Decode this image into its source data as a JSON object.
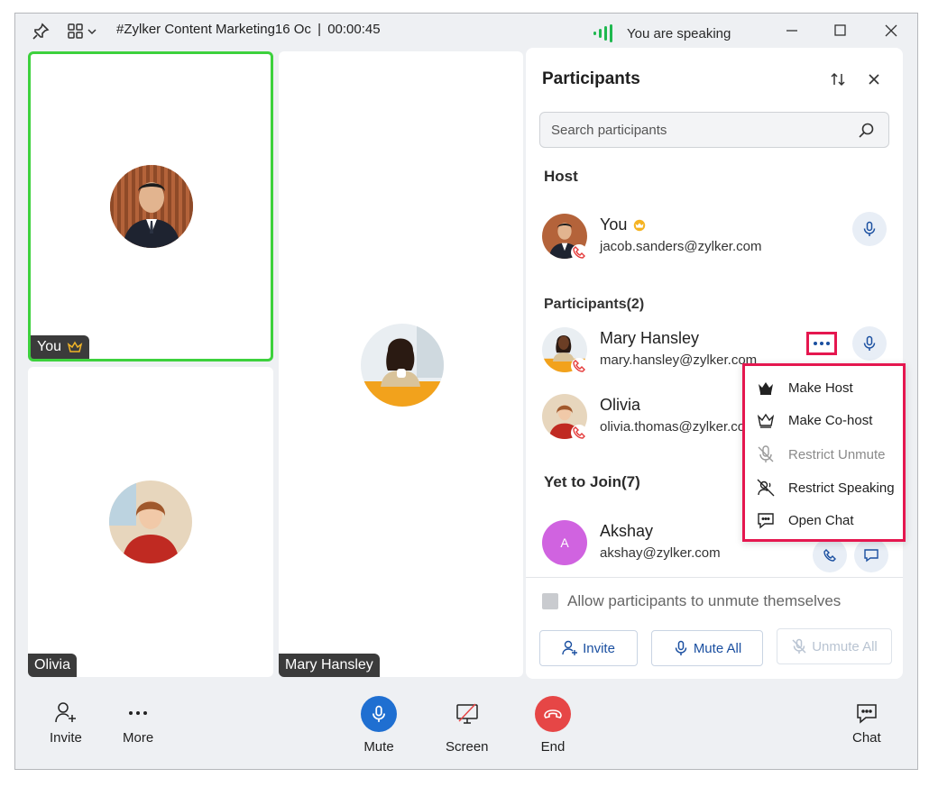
{
  "titlebar": {
    "meeting_title": "#Zylker Content Marketing16 Oc",
    "separator": "|",
    "timer": "00:00:45",
    "speaking_status": "You are speaking",
    "speaking_color": "#1fb84f"
  },
  "tiles": {
    "you_label": "You",
    "olivia_label": "Olivia",
    "mary_label": "Mary Hansley",
    "active_border_color": "#3dd13d"
  },
  "panel": {
    "title": "Participants",
    "search_placeholder": "Search participants",
    "host_heading": "Host",
    "host": {
      "name": "You",
      "email": "jacob.sanders@zylker.com"
    },
    "participants_heading": "Participants(2)",
    "participants": [
      {
        "name": "Mary Hansley",
        "email": "mary.hansley@zylker.com"
      },
      {
        "name": "Olivia",
        "email": "olivia.thomas@zylker.com"
      }
    ],
    "yet_to_join_heading": "Yet to Join(7)",
    "yet_to_join": [
      {
        "initial": "A",
        "name": "Akshay",
        "email": "akshay@zylker.com"
      }
    ],
    "allow_unmute_label": "Allow participants to unmute themselves",
    "invite_label": "Invite",
    "mute_all_label": "Mute All",
    "unmute_all_label": "Unmute All"
  },
  "context_menu": {
    "items": [
      {
        "label": "Make Host",
        "icon": "crown-icon",
        "enabled": true
      },
      {
        "label": "Make Co-host",
        "icon": "crown-outline-icon",
        "enabled": true
      },
      {
        "label": "Restrict Unmute",
        "icon": "mic-off-icon",
        "enabled": false
      },
      {
        "label": "Restrict Speaking",
        "icon": "speaking-off-icon",
        "enabled": true
      },
      {
        "label": "Open Chat",
        "icon": "chat-icon",
        "enabled": true
      }
    ],
    "highlight_color": "#e5174f"
  },
  "toolbar": {
    "invite_label": "Invite",
    "more_label": "More",
    "mute_label": "Mute",
    "screen_label": "Screen",
    "end_label": "End",
    "chat_label": "Chat",
    "mute_color": "#1f6fd1",
    "end_color": "#e64646"
  }
}
